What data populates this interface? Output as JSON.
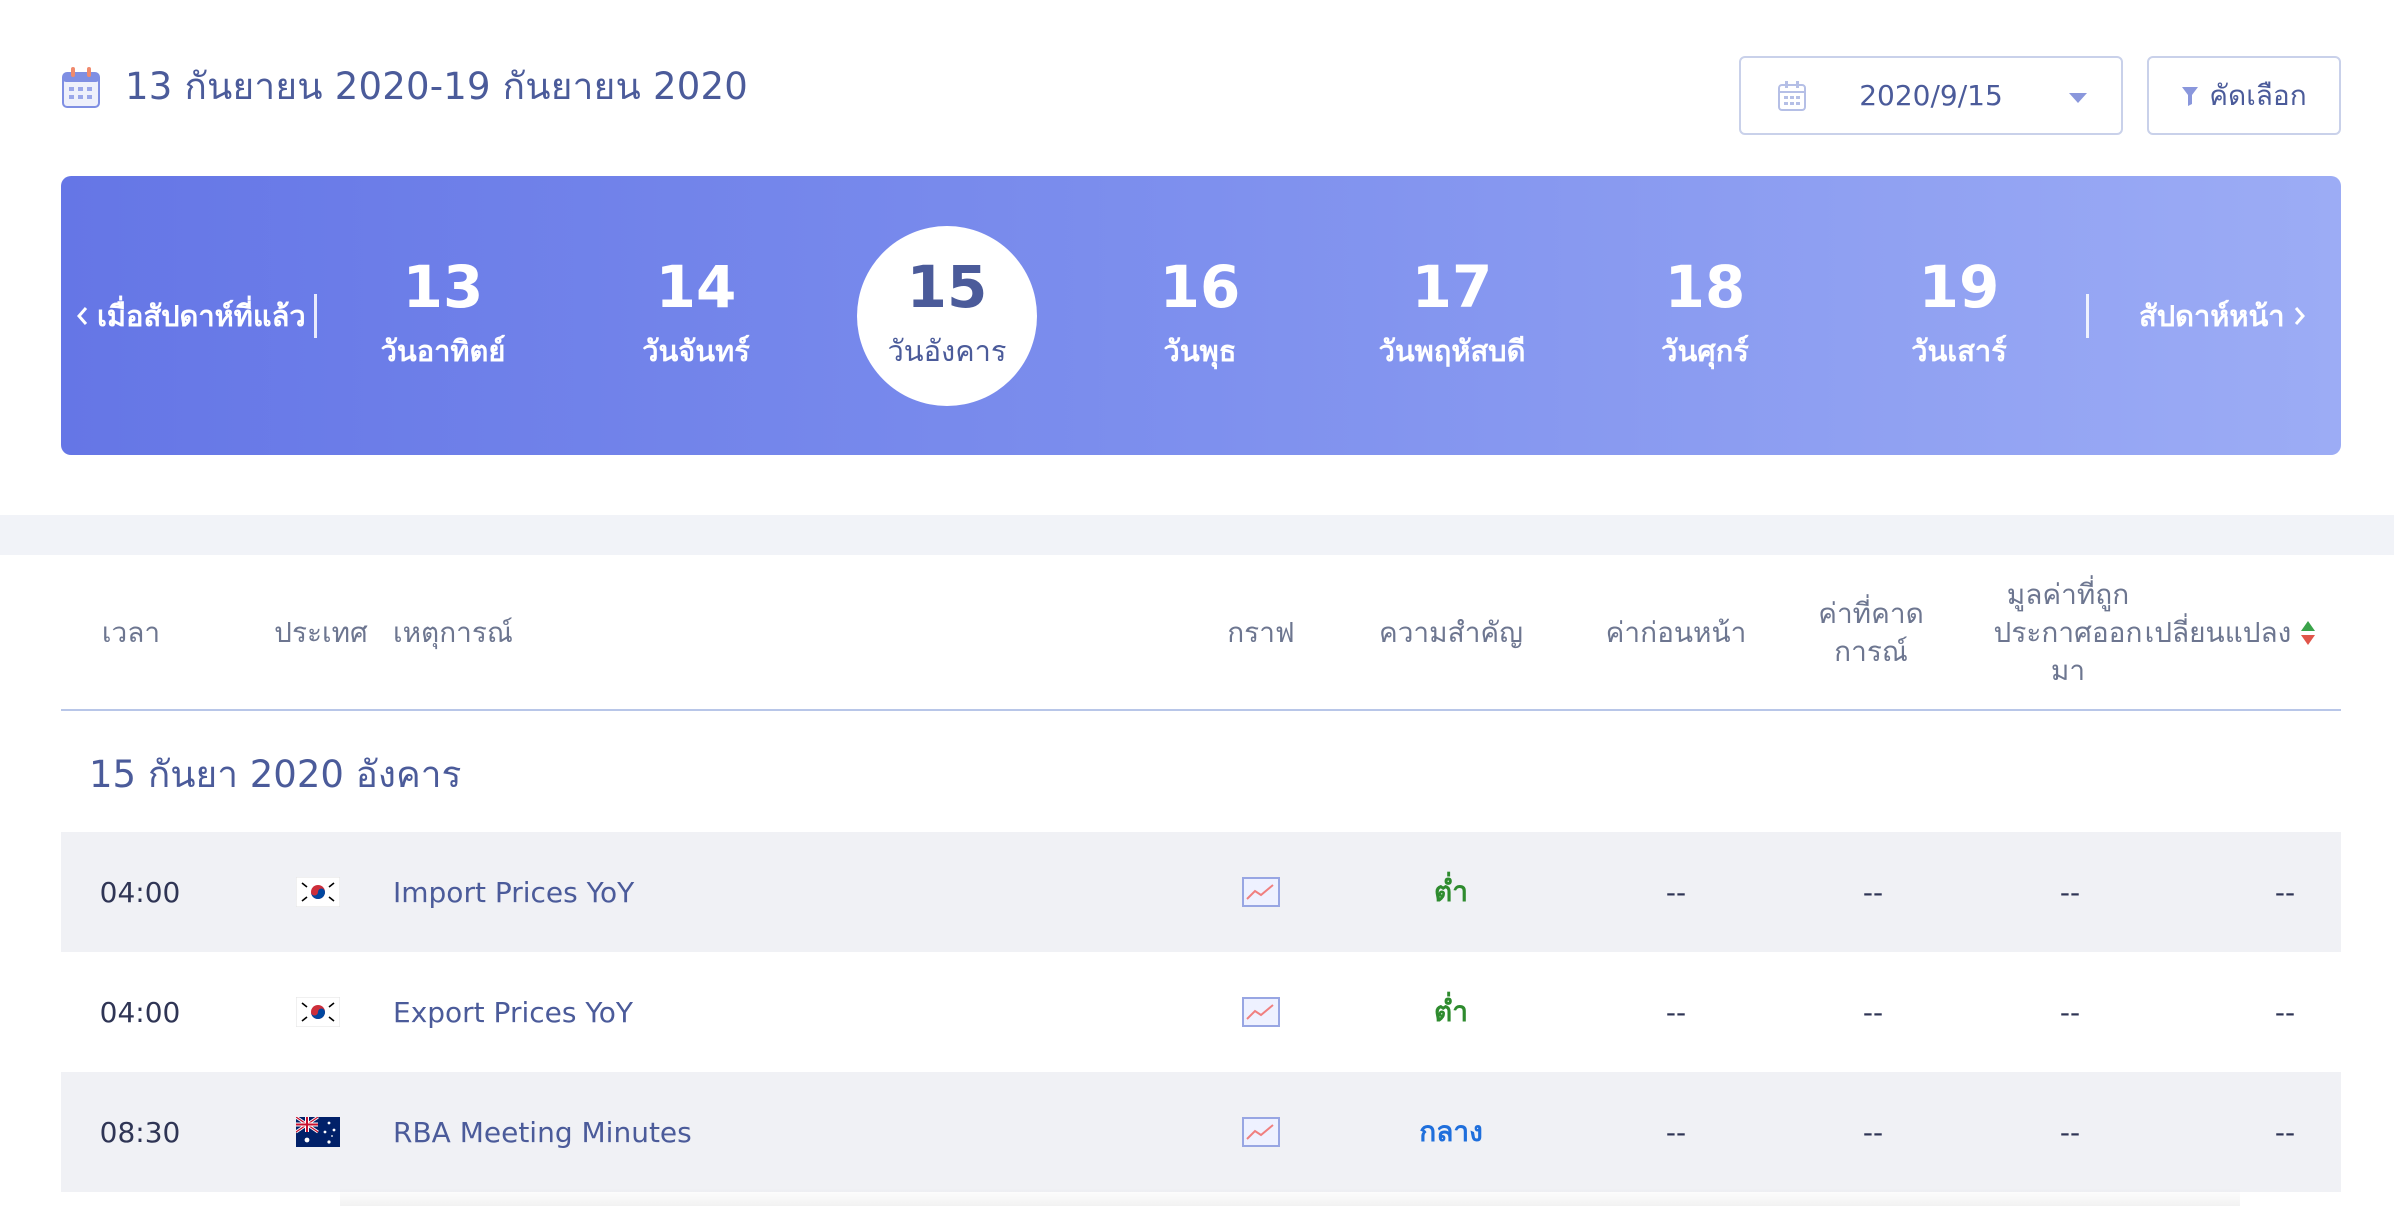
{
  "header": {
    "range_title": "13 กันยายน 2020-19 กันยายน 2020",
    "calendar_icon": "calendar-icon",
    "date_value": "2020/9/15",
    "filter_label": "คัดเลือก"
  },
  "week": {
    "prev_label": "เมื่อสัปดาห์ที่แล้ว",
    "next_label": "สัปดาห์หน้า",
    "days": [
      {
        "num": "13",
        "name": "วันอาทิตย์"
      },
      {
        "num": "14",
        "name": "วันจันทร์"
      },
      {
        "num": "15",
        "name": "วันอังคาร"
      },
      {
        "num": "16",
        "name": "วันพุธ"
      },
      {
        "num": "17",
        "name": "วันพฤหัสบดี"
      },
      {
        "num": "18",
        "name": "วันศุกร์"
      },
      {
        "num": "19",
        "name": "วันเสาร์"
      }
    ],
    "active_day": "15"
  },
  "table": {
    "headers": {
      "time": "เวลา",
      "country": "ประเทศ",
      "event": "เหตุการณ์",
      "chart": "กราฟ",
      "importance": "ความสำคัญ",
      "previous": "ค่าก่อนหน้า",
      "forecast_1": "ค่าที่คาด",
      "forecast_2": "การณ์",
      "actual_1": "มูลค่าที่ถูก",
      "actual_2": "ประกาศออก",
      "actual_3": "มา",
      "change": "เปลี่ยนแปลง"
    },
    "date_heading": "15 กันยา 2020 อังคาร",
    "rows": [
      {
        "time": "04:00",
        "country_flag": "south-korea-flag-icon",
        "event": "Import Prices YoY",
        "importance": "ต่ำ",
        "previous": "--",
        "forecast": "--",
        "actual": "--",
        "change": "--"
      },
      {
        "time": "04:00",
        "country_flag": "south-korea-flag-icon",
        "event": "Export Prices YoY",
        "importance": "ต่ำ",
        "previous": "--",
        "forecast": "--",
        "actual": "--",
        "change": "--"
      },
      {
        "time": "08:30",
        "country_flag": "australia-flag-icon",
        "event": "RBA Meeting Minutes",
        "importance": "กลาง",
        "previous": "--",
        "forecast": "--",
        "actual": "--",
        "change": "--"
      }
    ]
  },
  "colors": {
    "accent": "#4b5b9a",
    "bar_start": "#6576e6",
    "bar_end": "#9cacf5",
    "importance_low": "#2e8b2e",
    "importance_mid": "#1f6fdc",
    "row_shade": "#f0f1f5"
  }
}
